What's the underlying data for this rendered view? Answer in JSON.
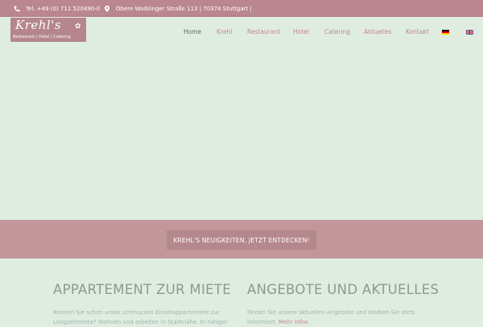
{
  "topbar": {
    "phone": "Tel. +49 (0) 711 520490-0",
    "address": "Obere Waiblinger Straße 113 | 70374 Stuttgart |",
    "icons": [
      "phone-icon",
      "map-pin-icon"
    ]
  },
  "logo": {
    "script": "Krehl's",
    "tagline": "Restaurant | Hotel | Catering"
  },
  "nav": {
    "items": [
      "Home",
      "Krehl",
      "Restaurant",
      "Hotel",
      "Catering",
      "Aktuelles",
      "Kontakt"
    ],
    "active": "Home",
    "languages": [
      "de",
      "en"
    ]
  },
  "band": {
    "cta_label": "KREHL'S NEUIGKEITEN, JETZT ENTDECKEN!"
  },
  "columns": [
    {
      "title": "APPARTEMENT ZUR MIETE",
      "text": "Kennen Sie schon unser schmuckes Einzelappartement zur Langzeitmiete? Wohnen und arbeiten in Stadtnähe. In ruhiger"
    },
    {
      "title": "ANGEBOTE UND AKTUELLES",
      "text": "Finden Sie unsere aktuellen Angebote und bleiben Sie stets informiert.",
      "link": "Mehr Infos"
    }
  ],
  "colors": {
    "accent": "#ba868f",
    "background": "#dfede1",
    "band": "#c1979a"
  }
}
